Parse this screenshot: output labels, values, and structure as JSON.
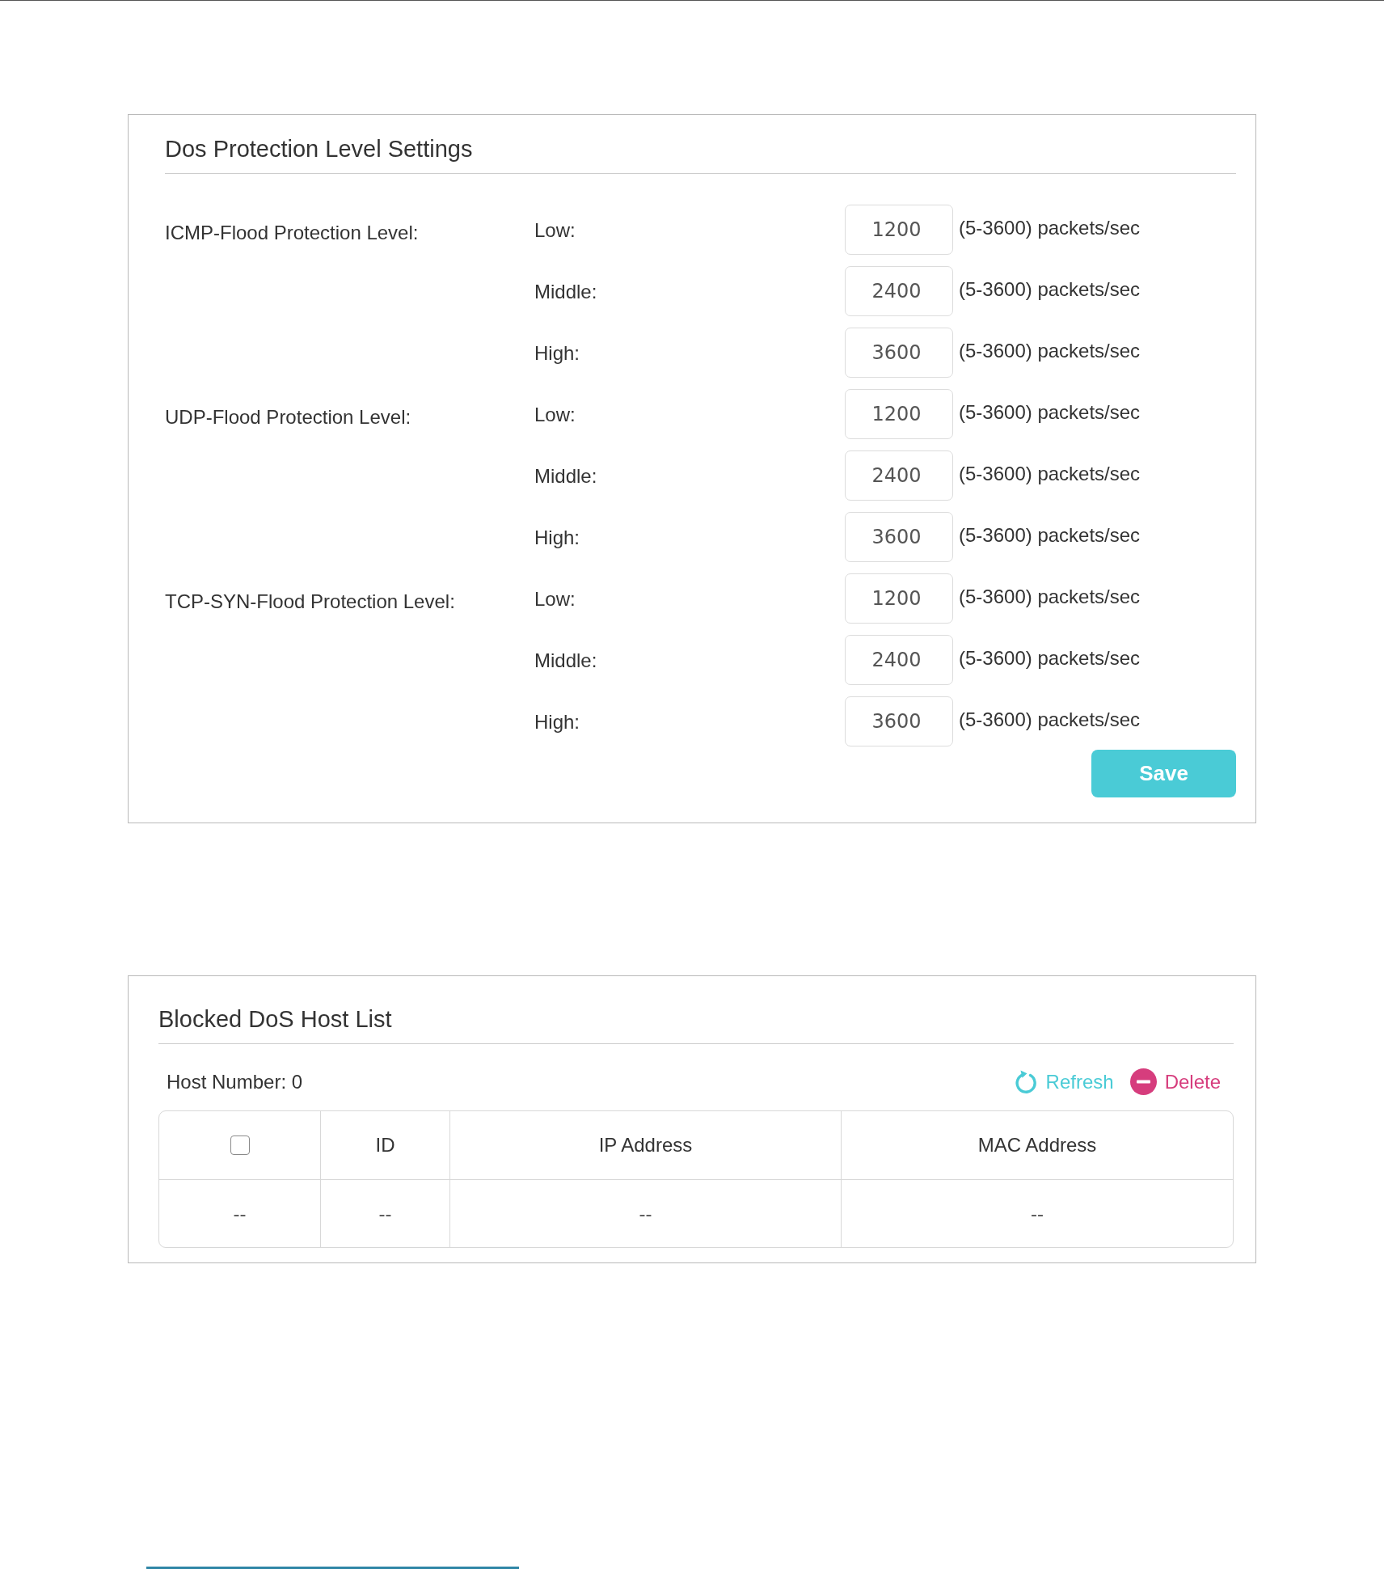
{
  "protection_settings": {
    "title": "Dos Protection Level Settings",
    "groups": [
      {
        "label": "ICMP-Flood Protection Level:",
        "levels": [
          {
            "label": "Low:",
            "value": "1200",
            "range": "(5-3600) packets/sec"
          },
          {
            "label": "Middle:",
            "value": "2400",
            "range": "(5-3600) packets/sec"
          },
          {
            "label": "High:",
            "value": "3600",
            "range": "(5-3600) packets/sec"
          }
        ]
      },
      {
        "label": "UDP-Flood Protection Level:",
        "levels": [
          {
            "label": "Low:",
            "value": "1200",
            "range": "(5-3600) packets/sec"
          },
          {
            "label": "Middle:",
            "value": "2400",
            "range": "(5-3600) packets/sec"
          },
          {
            "label": "High:",
            "value": "3600",
            "range": "(5-3600) packets/sec"
          }
        ]
      },
      {
        "label": "TCP-SYN-Flood Protection Level:",
        "levels": [
          {
            "label": "Low:",
            "value": "1200",
            "range": "(5-3600) packets/sec"
          },
          {
            "label": "Middle:",
            "value": "2400",
            "range": "(5-3600) packets/sec"
          },
          {
            "label": "High:",
            "value": "3600",
            "range": "(5-3600) packets/sec"
          }
        ]
      }
    ],
    "save_button": "Save"
  },
  "blocked_hosts": {
    "title": "Blocked DoS Host List",
    "host_number": "Host Number: 0",
    "actions": [
      {
        "kind": "refresh",
        "label": "Refresh"
      },
      {
        "kind": "delete",
        "label": "Delete"
      }
    ],
    "table": {
      "columns": [
        {
          "kind": "checkbox",
          "checked": false
        },
        {
          "kind": "text",
          "label": "ID"
        },
        {
          "kind": "text",
          "label": "IP Address"
        },
        {
          "kind": "text",
          "label": "MAC Address"
        }
      ],
      "rows": [
        {
          "cells": [
            "--",
            "--",
            "--",
            "--"
          ]
        }
      ]
    }
  }
}
